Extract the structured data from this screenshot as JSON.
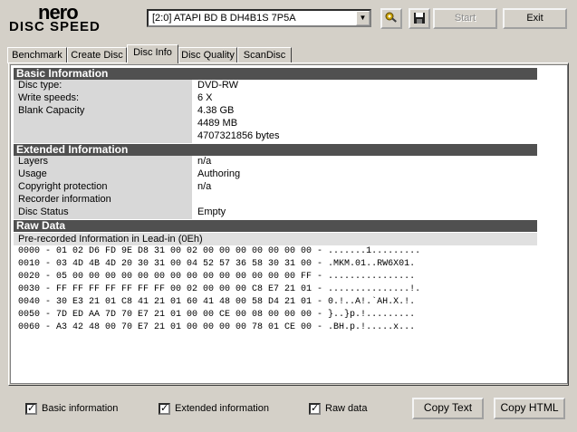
{
  "logo": {
    "line1": "nero",
    "line2": "DISC SPEED"
  },
  "drive": {
    "selected": "[2:0]   ATAPI BD  B  DH4B1S 7P5A"
  },
  "icons": {
    "settings": "wrench-gear-icon",
    "save": "floppy-disk-icon",
    "dropdown": "chevron-down-icon"
  },
  "toolbar": {
    "start_label": "Start",
    "exit_label": "Exit"
  },
  "tabs": [
    {
      "label": "Benchmark"
    },
    {
      "label": "Create Disc"
    },
    {
      "label": "Disc Info"
    },
    {
      "label": "Disc Quality"
    },
    {
      "label": "ScanDisc"
    }
  ],
  "basic": {
    "header": "Basic Information",
    "rows": [
      {
        "key": "Disc type:",
        "value": "DVD-RW"
      },
      {
        "key": "Write speeds:",
        "value": "6 X"
      },
      {
        "key": "Blank Capacity",
        "value": "4.38 GB"
      },
      {
        "key": "",
        "value": "4489 MB"
      },
      {
        "key": "",
        "value": "4707321856 bytes"
      }
    ]
  },
  "extended": {
    "header": "Extended Information",
    "rows": [
      {
        "key": "Layers",
        "value": "n/a"
      },
      {
        "key": "Usage",
        "value": "Authoring"
      },
      {
        "key": "Copyright protection",
        "value": "n/a"
      },
      {
        "key": "Recorder information",
        "value": ""
      },
      {
        "key": "Disc Status",
        "value": "Empty"
      }
    ]
  },
  "raw": {
    "header": "Raw Data",
    "label": "Pre-recorded Information in Lead-in (0Eh)",
    "lines": [
      "0000 - 01 02 D6 FD 9E D8 31 00 02 00 00 00 00 00 00 00 - .......1.........",
      "0010 - 03 4D 4B 4D 20 30 31 00 04 52 57 36 58 30 31 00 - .MKM.01..RW6X01.",
      "0020 - 05 00 00 00 00 00 00 00 00 00 00 00 00 00 00 FF - ................",
      "0030 - FF FF FF FF FF FF FF 00 02 00 00 00 C8 E7 21 01 - ...............!.",
      "0040 - 30 E3 21 01 C8 41 21 01 60 41 48 00 58 D4 21 01 - 0.!..A!.`AH.X.!.",
      "0050 - 7D ED AA 7D 70 E7 21 01 00 00 CE 00 08 00 00 00 - }..}p.!.........",
      "0060 - A3 42 48 00 70 E7 21 01 00 00 00 00 78 01 CE 00 - .BH.p.!.....x..."
    ]
  },
  "footer": {
    "cb_basic": "Basic information",
    "cb_extended": "Extended information",
    "cb_raw": "Raw data",
    "check_mark": "✓",
    "copy_text": "Copy Text",
    "copy_html": "Copy HTML"
  }
}
